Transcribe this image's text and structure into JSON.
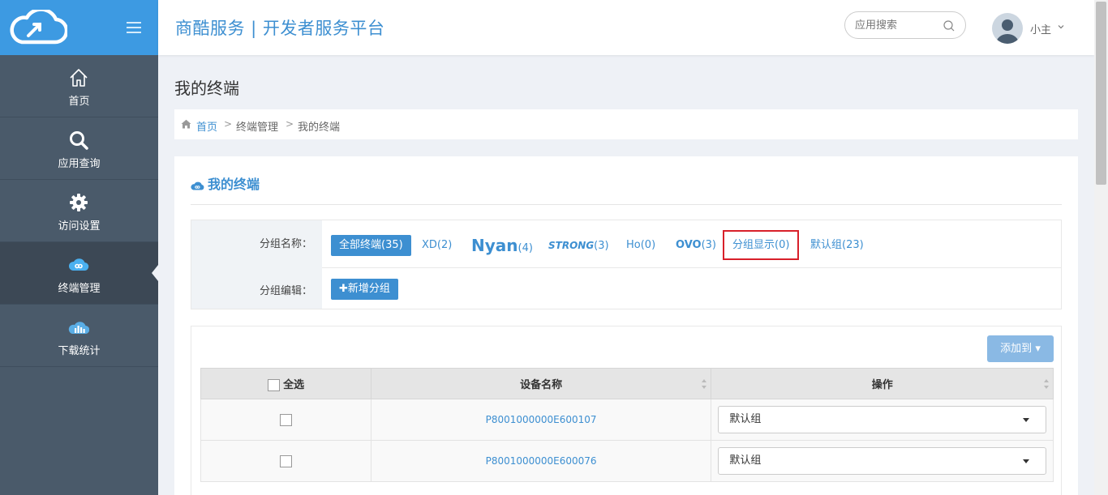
{
  "app": {
    "title": "商酷服务 | 开发者服务平台",
    "brand_color": "#3d9ae2"
  },
  "sidebar": {
    "items": [
      {
        "label": "首页",
        "icon": "home-icon",
        "active": false
      },
      {
        "label": "应用查询",
        "icon": "search-icon",
        "active": false
      },
      {
        "label": "访问设置",
        "icon": "gear-icon",
        "active": false
      },
      {
        "label": "终端管理",
        "icon": "cloud-link-icon",
        "active": true
      },
      {
        "label": "下载统计",
        "icon": "bar-chart-cloud-icon",
        "active": false
      }
    ]
  },
  "header": {
    "search_placeholder": "应用搜索",
    "user_name": "小主"
  },
  "page": {
    "title": "我的终端",
    "breadcrumb": [
      "首页",
      "终端管理",
      "我的终端"
    ],
    "breadcrumb_sep": ">"
  },
  "card": {
    "title": "我的终端",
    "group_name_label": "分组名称：",
    "group_edit_label": "分组编辑：",
    "add_group_button": "新增分组",
    "groups": [
      {
        "name": "全部终端",
        "count": "(35)",
        "selected": true
      },
      {
        "name": "XD",
        "count": "(2)"
      },
      {
        "name": "Nyan",
        "count": "(4)"
      },
      {
        "name": "STRONG",
        "count": "(3)"
      },
      {
        "name": "Ho",
        "count": "(0)"
      },
      {
        "name": "OVO",
        "count": "(3)"
      },
      {
        "name": "分组显示",
        "count": "(0)",
        "highlighted": true
      },
      {
        "name": "默认组",
        "count": "(23)"
      }
    ]
  },
  "table": {
    "add_to_button": "添加到",
    "headers": {
      "select_all": "全选",
      "device_name": "设备名称",
      "action": "操作"
    },
    "rows": [
      {
        "device": "P8001000000E600107",
        "group": "默认组"
      },
      {
        "device": "P8001000000E600076",
        "group": "默认组"
      }
    ]
  }
}
